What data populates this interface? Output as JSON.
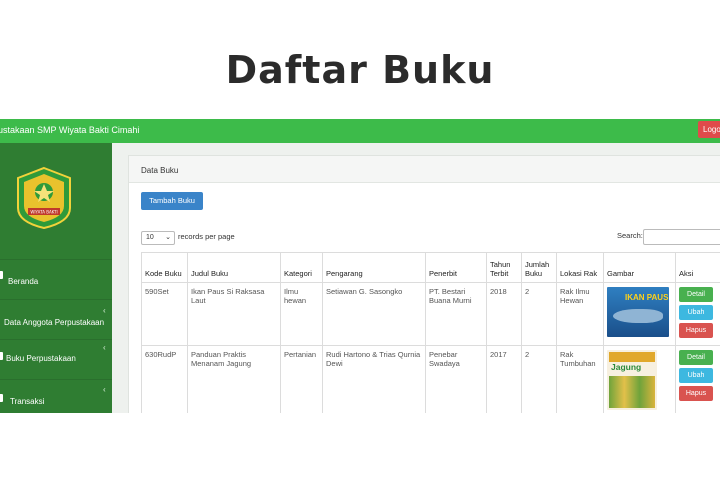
{
  "heading": "Daftar Buku",
  "topbar": {
    "title": "ustakaan SMP Wiyata Bakti Cimahi",
    "logout": "Logo"
  },
  "sidebar": {
    "logo_caption": "WIYATA BAKTI",
    "items": [
      {
        "label": "Beranda"
      },
      {
        "label": "Data Anggota Perpustakaan"
      },
      {
        "label": "Buku Perpustakaan"
      },
      {
        "label": "Transaksi"
      }
    ]
  },
  "panel": {
    "header": "Data Buku",
    "add_button": "Tambah Buku",
    "length_value": "10",
    "length_suffix": "records per page",
    "search_label": "Search:"
  },
  "table": {
    "headers": [
      "Kode Buku",
      "Judul Buku",
      "Kategori",
      "Pengarang",
      "Penerbit",
      "Tahun Terbit",
      "Jumlah Buku",
      "Lokasi Rak",
      "Gambar",
      "Aksi"
    ],
    "rows": [
      {
        "kode": "590Set",
        "judul": "Ikan Paus Si Raksasa Laut",
        "kategori": "Ilmu hewan",
        "pengarang": "Setiawan G. Sasongko",
        "penerbit": "PT. Bestari Buana Murni",
        "tahun": "2018",
        "jumlah": "2",
        "lokasi": "Rak Ilmu Hewan",
        "cover_title": "IKAN PAUS"
      },
      {
        "kode": "630RudP",
        "judul": "Panduan Praktis Menanam Jagung",
        "kategori": "Pertanian",
        "pengarang": "Rudi Hartono & Trias Qurnia Dewi",
        "penerbit": "Penebar Swadaya",
        "tahun": "2017",
        "jumlah": "2",
        "lokasi": "Rak Tumbuhan",
        "cover_title": "Jagung"
      }
    ],
    "actions": {
      "detail": "Detail",
      "edit": "Ubah",
      "delete": "Hapus"
    }
  },
  "colors": {
    "topbar": "#3dbb4a",
    "sidebar": "#2f7d32",
    "primary": "#3a84c9",
    "success": "#48b04f",
    "info": "#3db8e0",
    "danger": "#d9534f"
  }
}
